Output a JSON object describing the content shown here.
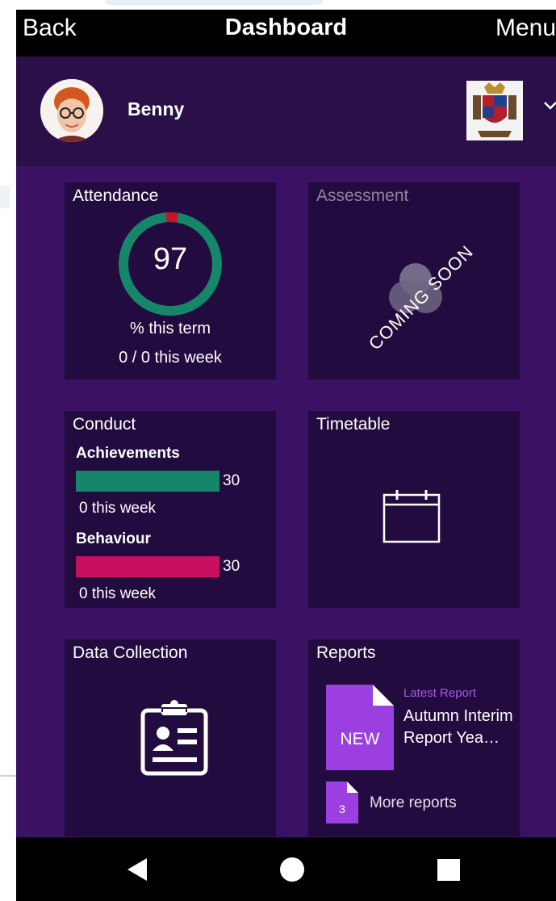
{
  "nav": {
    "back_label": "Back",
    "title": "Dashboard",
    "menu_label": "Menu"
  },
  "user": {
    "name": "Benny",
    "avatar_icon": "student-avatar",
    "school_icon": "school-crest-icon",
    "switch_icon": "chevron-down-icon"
  },
  "attendance": {
    "title": "Attendance",
    "percent": "97",
    "percent_caption": "% this term",
    "week": "0 / 0 this week",
    "present_color": "#16866a",
    "absent_color": "#c0182b"
  },
  "assessment": {
    "title": "Assessment",
    "badge": "COMING SOON",
    "icon": "venn-icon"
  },
  "conduct": {
    "title": "Conduct",
    "achievements": {
      "label": "Achievements",
      "value": "30",
      "week": "0 this week",
      "color": "#16866a"
    },
    "behaviour": {
      "label": "Behaviour",
      "value": "30",
      "week": "0 this week",
      "color": "#c8105e"
    }
  },
  "timetable": {
    "title": "Timetable",
    "icon": "calendar-icon"
  },
  "data_collection": {
    "title": "Data Collection",
    "icon": "clipboard-icon"
  },
  "reports": {
    "title": "Reports",
    "new_badge": "NEW",
    "latest_label": "Latest Report",
    "latest_name": "Autumn Interim Report Yea…",
    "more_count": "3",
    "more_label": "More reports"
  },
  "system_nav": {
    "back_icon": "triangle-back-icon",
    "home_icon": "circle-home-icon",
    "recents_icon": "square-recents-icon"
  }
}
